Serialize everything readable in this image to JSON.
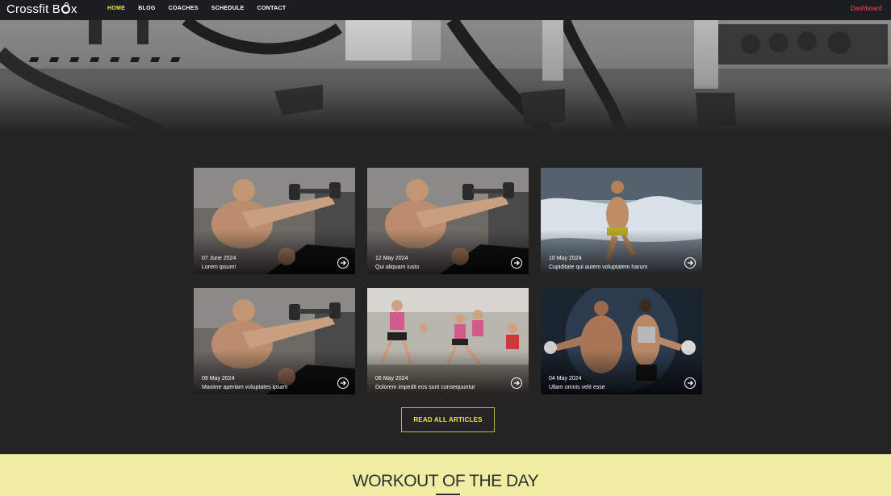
{
  "brand": {
    "name_part1": "Crossfit B",
    "name_part2": "x"
  },
  "nav": {
    "links": [
      {
        "label": "HOME",
        "active": true
      },
      {
        "label": "BLOG",
        "active": false
      },
      {
        "label": "COACHES",
        "active": false
      },
      {
        "label": "SCHEDULE",
        "active": false
      },
      {
        "label": "CONTACT",
        "active": false
      }
    ],
    "dashboard_label": "Dashboard"
  },
  "articles": [
    {
      "date": "07 June 2024",
      "title": "Lorem ipsum!",
      "image": "dumbbell-press"
    },
    {
      "date": "12 May 2024",
      "title": "Qui aliquam iusto",
      "image": "dumbbell-press"
    },
    {
      "date": "10 May 2024",
      "title": "Cupiditate qui autem voluptatem harum",
      "image": "beach-runner"
    },
    {
      "date": "09 May 2024",
      "title": "Maxime aperiam voluptates ipsam",
      "image": "dumbbell-press"
    },
    {
      "date": "06 May 2024",
      "title": "Dolorem impedit eos sunt consequuntur",
      "image": "group-lunges"
    },
    {
      "date": "04 May 2024",
      "title": "Ullam omnis velit esse",
      "image": "fitness-couple"
    }
  ],
  "read_all_label": "READ ALL ARTICLES",
  "workout": {
    "title": "WORKOUT OF THE DAY"
  },
  "colors": {
    "accent": "#f1ea4a",
    "dashboard": "#ff4a4a",
    "wod_bg": "#f0eea2",
    "page_bg": "#242424"
  }
}
